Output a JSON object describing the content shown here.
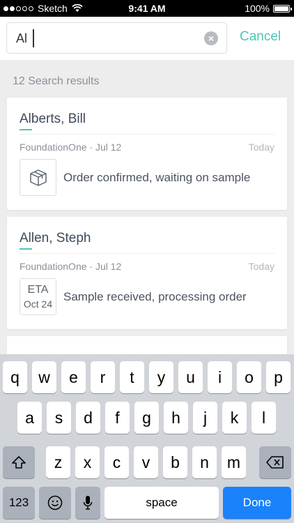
{
  "status_bar": {
    "carrier": "Sketch",
    "time": "9:41 AM",
    "battery": "100%",
    "signal_bars_filled": 2,
    "signal_bars_total": 5
  },
  "search": {
    "query": "Al",
    "cancel_label": "Cancel",
    "clear_icon": "clear-icon"
  },
  "results_count": "12 Search results",
  "results": [
    {
      "name": "Alberts, Bill",
      "source": "FoundationOne · Jul 12",
      "date": "Today",
      "icon": "box-icon",
      "status": "Order confirmed, waiting on sample"
    },
    {
      "name": "Allen, Steph",
      "source": "FoundationOne · Jul 12",
      "date": "Today",
      "eta_label": "ETA",
      "eta_date": "Oct 24",
      "status": "Sample received, processing order"
    }
  ],
  "keyboard": {
    "row1": [
      "q",
      "w",
      "e",
      "r",
      "t",
      "y",
      "u",
      "i",
      "o",
      "p"
    ],
    "row2": [
      "a",
      "s",
      "d",
      "f",
      "g",
      "h",
      "j",
      "k",
      "l"
    ],
    "row3": [
      "z",
      "x",
      "c",
      "v",
      "b",
      "n",
      "m"
    ],
    "numbers_label": "123",
    "space_label": "space",
    "done_label": "Done"
  },
  "colors": {
    "accent": "#4fc3b8",
    "done_button": "#1a82fb"
  }
}
